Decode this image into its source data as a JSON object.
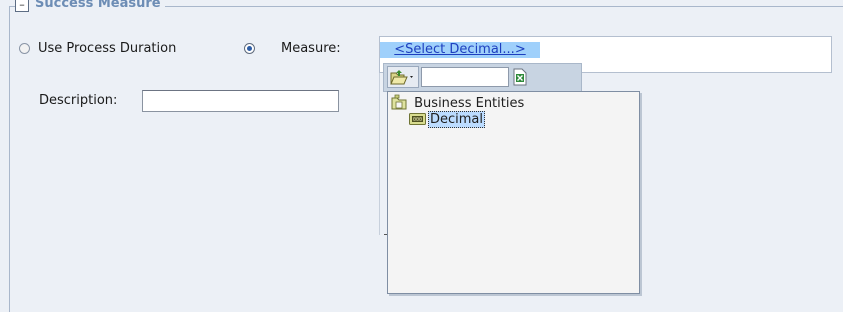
{
  "section": {
    "legend": "Success Measure",
    "collapse_symbol": "–"
  },
  "options": {
    "use_process_duration": {
      "label": "Use Process Duration",
      "checked": false
    },
    "measure": {
      "label": "Measure:",
      "checked": true
    }
  },
  "measure_field": {
    "link_text": "<Select Decimal...>"
  },
  "description": {
    "label": "Description:",
    "value": ""
  },
  "picker": {
    "search_value": "",
    "tree": {
      "root": {
        "label": "Business Entities",
        "icon": "business-entities-folder-icon"
      },
      "children": [
        {
          "label": "Decimal",
          "icon": "decimal-type-icon",
          "selected": true
        }
      ]
    }
  },
  "icons": {
    "folder_menu": "open-folder-icon",
    "export": "excel-icon"
  },
  "colors": {
    "background": "#ecf0f6",
    "legend_text": "#6d8db5",
    "link_highlight": "#9fd0fb",
    "link_text": "#1d3fbf",
    "selected_node": "#bcdcff"
  }
}
